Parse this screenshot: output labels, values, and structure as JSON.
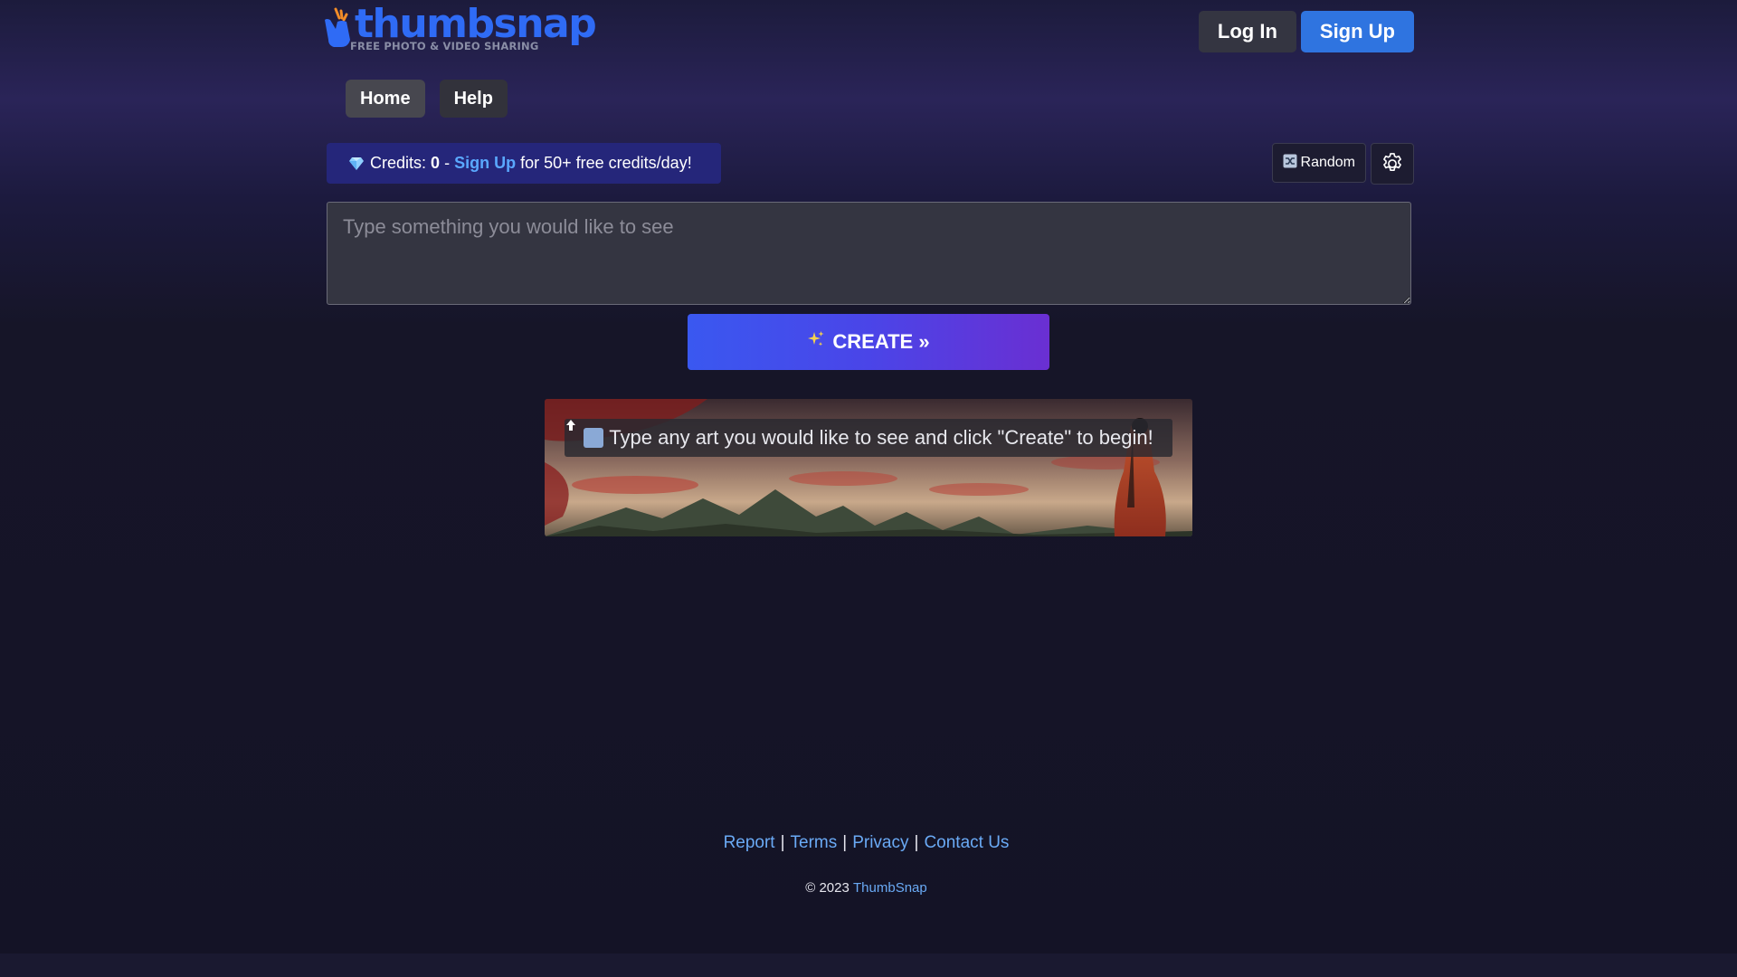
{
  "header": {
    "logo_text": "thumbsnap",
    "logo_tagline": "FREE PHOTO & VIDEO SHARING",
    "login_label": "Log In",
    "signup_label": "Sign Up"
  },
  "nav": {
    "home_label": "Home",
    "help_label": "Help"
  },
  "credits": {
    "prefix": "Credits:",
    "count": "0",
    "dash": "-",
    "signup_link": "Sign Up",
    "suffix": "for 50+ free credits/day!"
  },
  "toolbar": {
    "random_label": "Random",
    "settings_icon": "gear-icon",
    "random_icon": "shuffle-icon"
  },
  "prompt": {
    "placeholder": "Type something you would like to see",
    "value": ""
  },
  "create": {
    "label": "CREATE »",
    "icon": "sparkles-icon"
  },
  "banner": {
    "message": "Type any art you would like to see and click \"Create\" to begin!",
    "icon": "up-arrow-icon"
  },
  "footer": {
    "links": [
      "Report",
      "Terms",
      "Privacy",
      "Contact Us"
    ],
    "separator": "|",
    "copyright_prefix": "© 2023",
    "copyright_link": "ThumbSnap"
  },
  "colors": {
    "brand": "#2f6bf5",
    "signup_button": "#2f74e0",
    "credits_bg": "#25267a",
    "link": "#5aa8ff",
    "create_gradient_start": "#3a58f0",
    "create_gradient_end": "#6a2fd2"
  }
}
